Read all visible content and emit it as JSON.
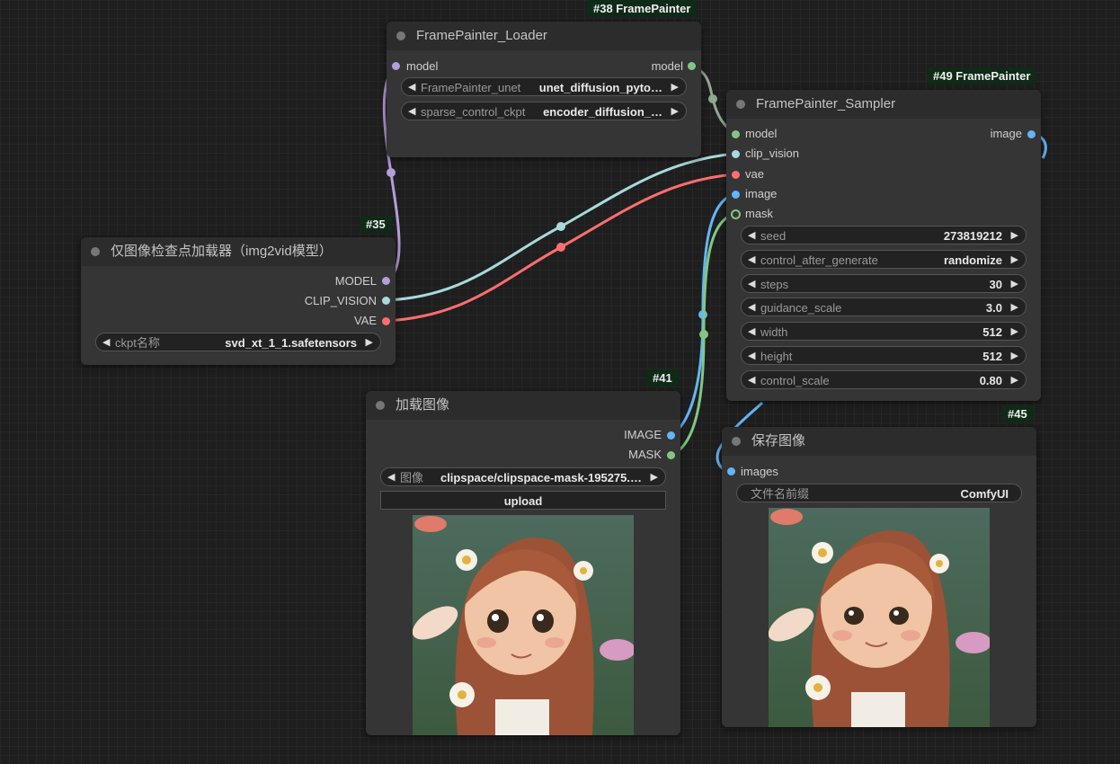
{
  "nodes": {
    "loader": {
      "badge": "#38 FramePainter",
      "title": "FramePainter_Loader",
      "input_model": "model",
      "output_model": "model",
      "widgets": [
        {
          "label": "FramePainter_unet",
          "value": "unet_diffusion_pyto…"
        },
        {
          "label": "sparse_control_ckpt",
          "value": "encoder_diffusion_…"
        }
      ]
    },
    "sampler": {
      "badge": "#49 FramePainter",
      "title": "FramePainter_Sampler",
      "inputs": [
        "model",
        "clip_vision",
        "vae",
        "image",
        "mask"
      ],
      "output_image": "image",
      "widgets": [
        {
          "label": "seed",
          "value": "273819212"
        },
        {
          "label": "control_after_generate",
          "value": "randomize"
        },
        {
          "label": "steps",
          "value": "30"
        },
        {
          "label": "guidance_scale",
          "value": "3.0"
        },
        {
          "label": "width",
          "value": "512"
        },
        {
          "label": "height",
          "value": "512"
        },
        {
          "label": "control_scale",
          "value": "0.80"
        }
      ]
    },
    "checkpoint": {
      "badge": "#35",
      "title": "仅图像检查点加载器（img2vid模型）",
      "outputs": [
        "MODEL",
        "CLIP_VISION",
        "VAE"
      ],
      "widget": {
        "label": "ckpt名称",
        "value": "svd_xt_1_1.safetensors"
      }
    },
    "load_image": {
      "badge": "#41",
      "title": "加载图像",
      "outputs": [
        "IMAGE",
        "MASK"
      ],
      "widget": {
        "label": "图像",
        "value": "clipspace/clipspace-mask-195275.…"
      },
      "upload_label": "upload"
    },
    "save_image": {
      "badge": "#45",
      "title": "保存图像",
      "input_images": "images",
      "widget": {
        "label": "文件名前缀",
        "value": "ComfyUI"
      }
    }
  },
  "colors": {
    "model": "#b39ddb",
    "clip_vision": "#a8dadc",
    "vae": "#ff6e6e",
    "image": "#64b5f6",
    "mask": "#81c784",
    "node_bg": "#353535",
    "badge_bg": "#0f2a17"
  }
}
